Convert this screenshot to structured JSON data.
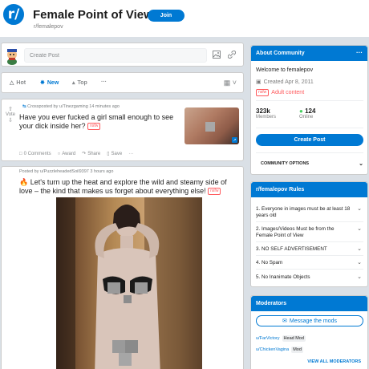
{
  "header": {
    "icon_text": "r/",
    "title": "Female Point of View",
    "slug": "r/femalepov",
    "join_label": "Join"
  },
  "create_post": {
    "placeholder": "Create Post"
  },
  "sort": {
    "hot": "Hot",
    "new": "New",
    "top": "Top",
    "more": "···"
  },
  "posts": [
    {
      "vote_label": "Vote",
      "meta": "Crossposted by u/Tinezgaming 14 minutes ago",
      "title": "Have you ever fucked a girl small enough to see your dick inside her?",
      "nsfw": "nsfw",
      "comments": "0 Comments",
      "award": "Award",
      "share": "Share",
      "save": "Save",
      "more": "···"
    },
    {
      "meta": "Posted by u/PuzzleheadedSoil9397 3 hours ago",
      "title": "🔥 Let's turn up the heat and explore the wild and steamy side of love – the kind that makes us forget about everything else!",
      "nsfw": "nsfw"
    }
  ],
  "about": {
    "heading": "About Community",
    "welcome": "Welcome to femalepov",
    "created": "Created Apr 8, 2011",
    "nsfw_badge": "nsfw",
    "adult": "Adult content",
    "members_count": "323k",
    "members_label": "Members",
    "online_count": "124",
    "online_label": "Online",
    "create_btn": "Create Post",
    "options": "COMMUNITY OPTIONS"
  },
  "rules": {
    "heading": "r/femalepov Rules",
    "items": [
      "1. Everyone in images must be at least 18 years old",
      "2. Images/Videos Must be from the Female Point of View",
      "3. NO SELF ADVERTISEMENT",
      "4. No Spam",
      "5. No Inanimate Objects"
    ]
  },
  "moderators": {
    "heading": "Moderators",
    "message_btn": "Message the mods",
    "mods": [
      {
        "name": "u/FarVictory",
        "flair": "Head Mod"
      },
      {
        "name": "u/ChickenVagina",
        "flair": "Mod"
      }
    ],
    "view_all": "VIEW ALL MODERATORS"
  },
  "colors": {
    "accent": "#0079d3",
    "nsfw": "#ff585b",
    "online": "#46d160"
  }
}
